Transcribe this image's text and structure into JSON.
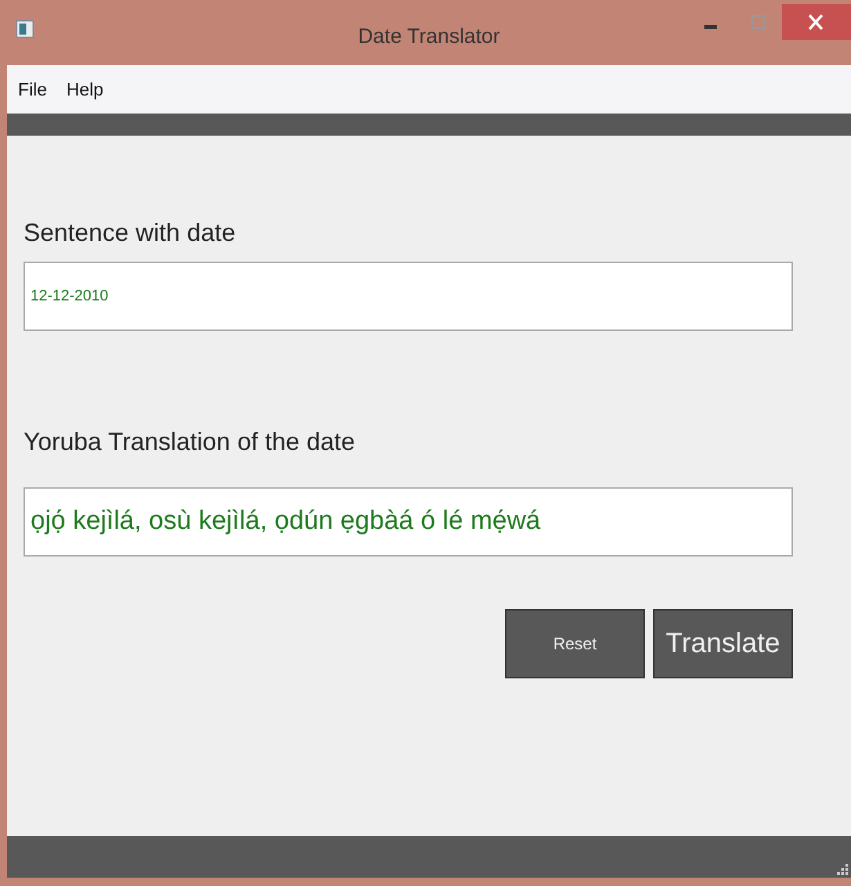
{
  "window": {
    "title": "Date Translator"
  },
  "menu": [
    "File",
    "Help"
  ],
  "fields": [
    {
      "label": "Sentence with date",
      "value": "12-12-2010",
      "kind": "small"
    },
    {
      "label": "Yoruba Translation of the date",
      "value": "ọjọ́ kejìlá, osù kejìlá, ọdún ẹgbàá ó lé mẹ́wá",
      "kind": "large"
    }
  ],
  "buttons": [
    {
      "label": "Reset",
      "kind": "small"
    },
    {
      "label": "Translate",
      "kind": "large"
    }
  ]
}
